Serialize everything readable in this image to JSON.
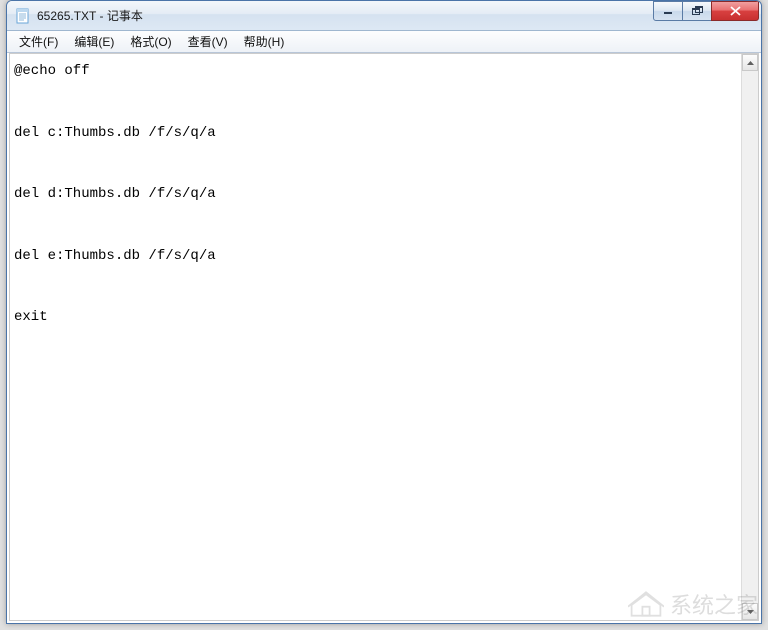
{
  "window": {
    "title": "65265.TXT - 记事本"
  },
  "menu": {
    "file": "文件(F)",
    "edit": "编辑(E)",
    "format": "格式(O)",
    "view": "查看(V)",
    "help": "帮助(H)"
  },
  "content": {
    "text": "@echo off\n\ndel c:Thumbs.db /f/s/q/a\n\ndel d:Thumbs.db /f/s/q/a\n\ndel e:Thumbs.db /f/s/q/a\n\nexit"
  },
  "watermark": {
    "text": "系统之家"
  }
}
